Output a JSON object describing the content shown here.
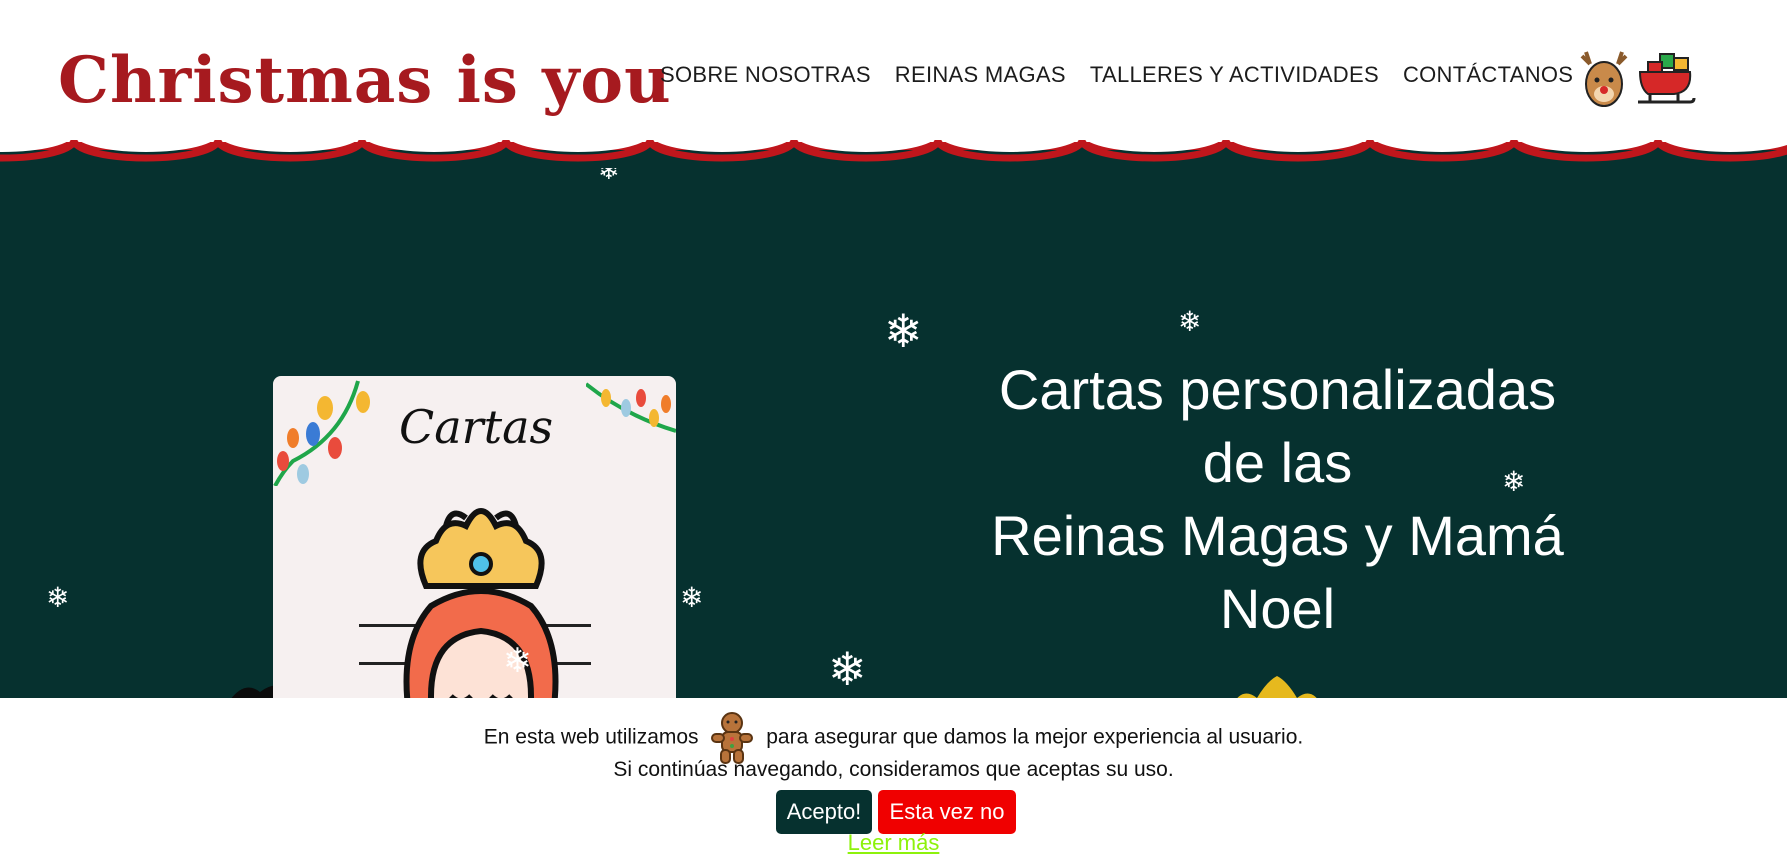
{
  "header": {
    "logo_text": "Christmas is you",
    "nav": [
      {
        "label": "SOBRE NOSOTRAS"
      },
      {
        "label": "REINAS MAGAS"
      },
      {
        "label": "TALLERES Y ACTIVIDADES"
      },
      {
        "label": "CONTÁCTANOS"
      }
    ],
    "nav_icons": [
      "reindeer-icon",
      "sleigh-icon"
    ]
  },
  "hero": {
    "title_lines": [
      "Cartas personalizadas",
      "de las",
      "Reinas Magas y Mamá",
      "Noel"
    ],
    "card_label": "Cartas"
  },
  "cookie": {
    "line1_before": "En esta web utilizamos",
    "line1_after": "para asegurar que damos la mejor experiencia al usuario.",
    "line2": "Si continúas navegando, consideramos que aceptas su uso.",
    "accept_label": "Acepto!",
    "decline_label": "Esta vez no",
    "read_more_label": "Leer más"
  },
  "colors": {
    "hero_bg": "#06312f",
    "header_bg": "#ffffff",
    "scallop_trim": "#c0161c",
    "accept_bg": "#06312f",
    "decline_bg": "#f00000",
    "read_more": "#8df20c",
    "logo": "#a61a1f"
  }
}
